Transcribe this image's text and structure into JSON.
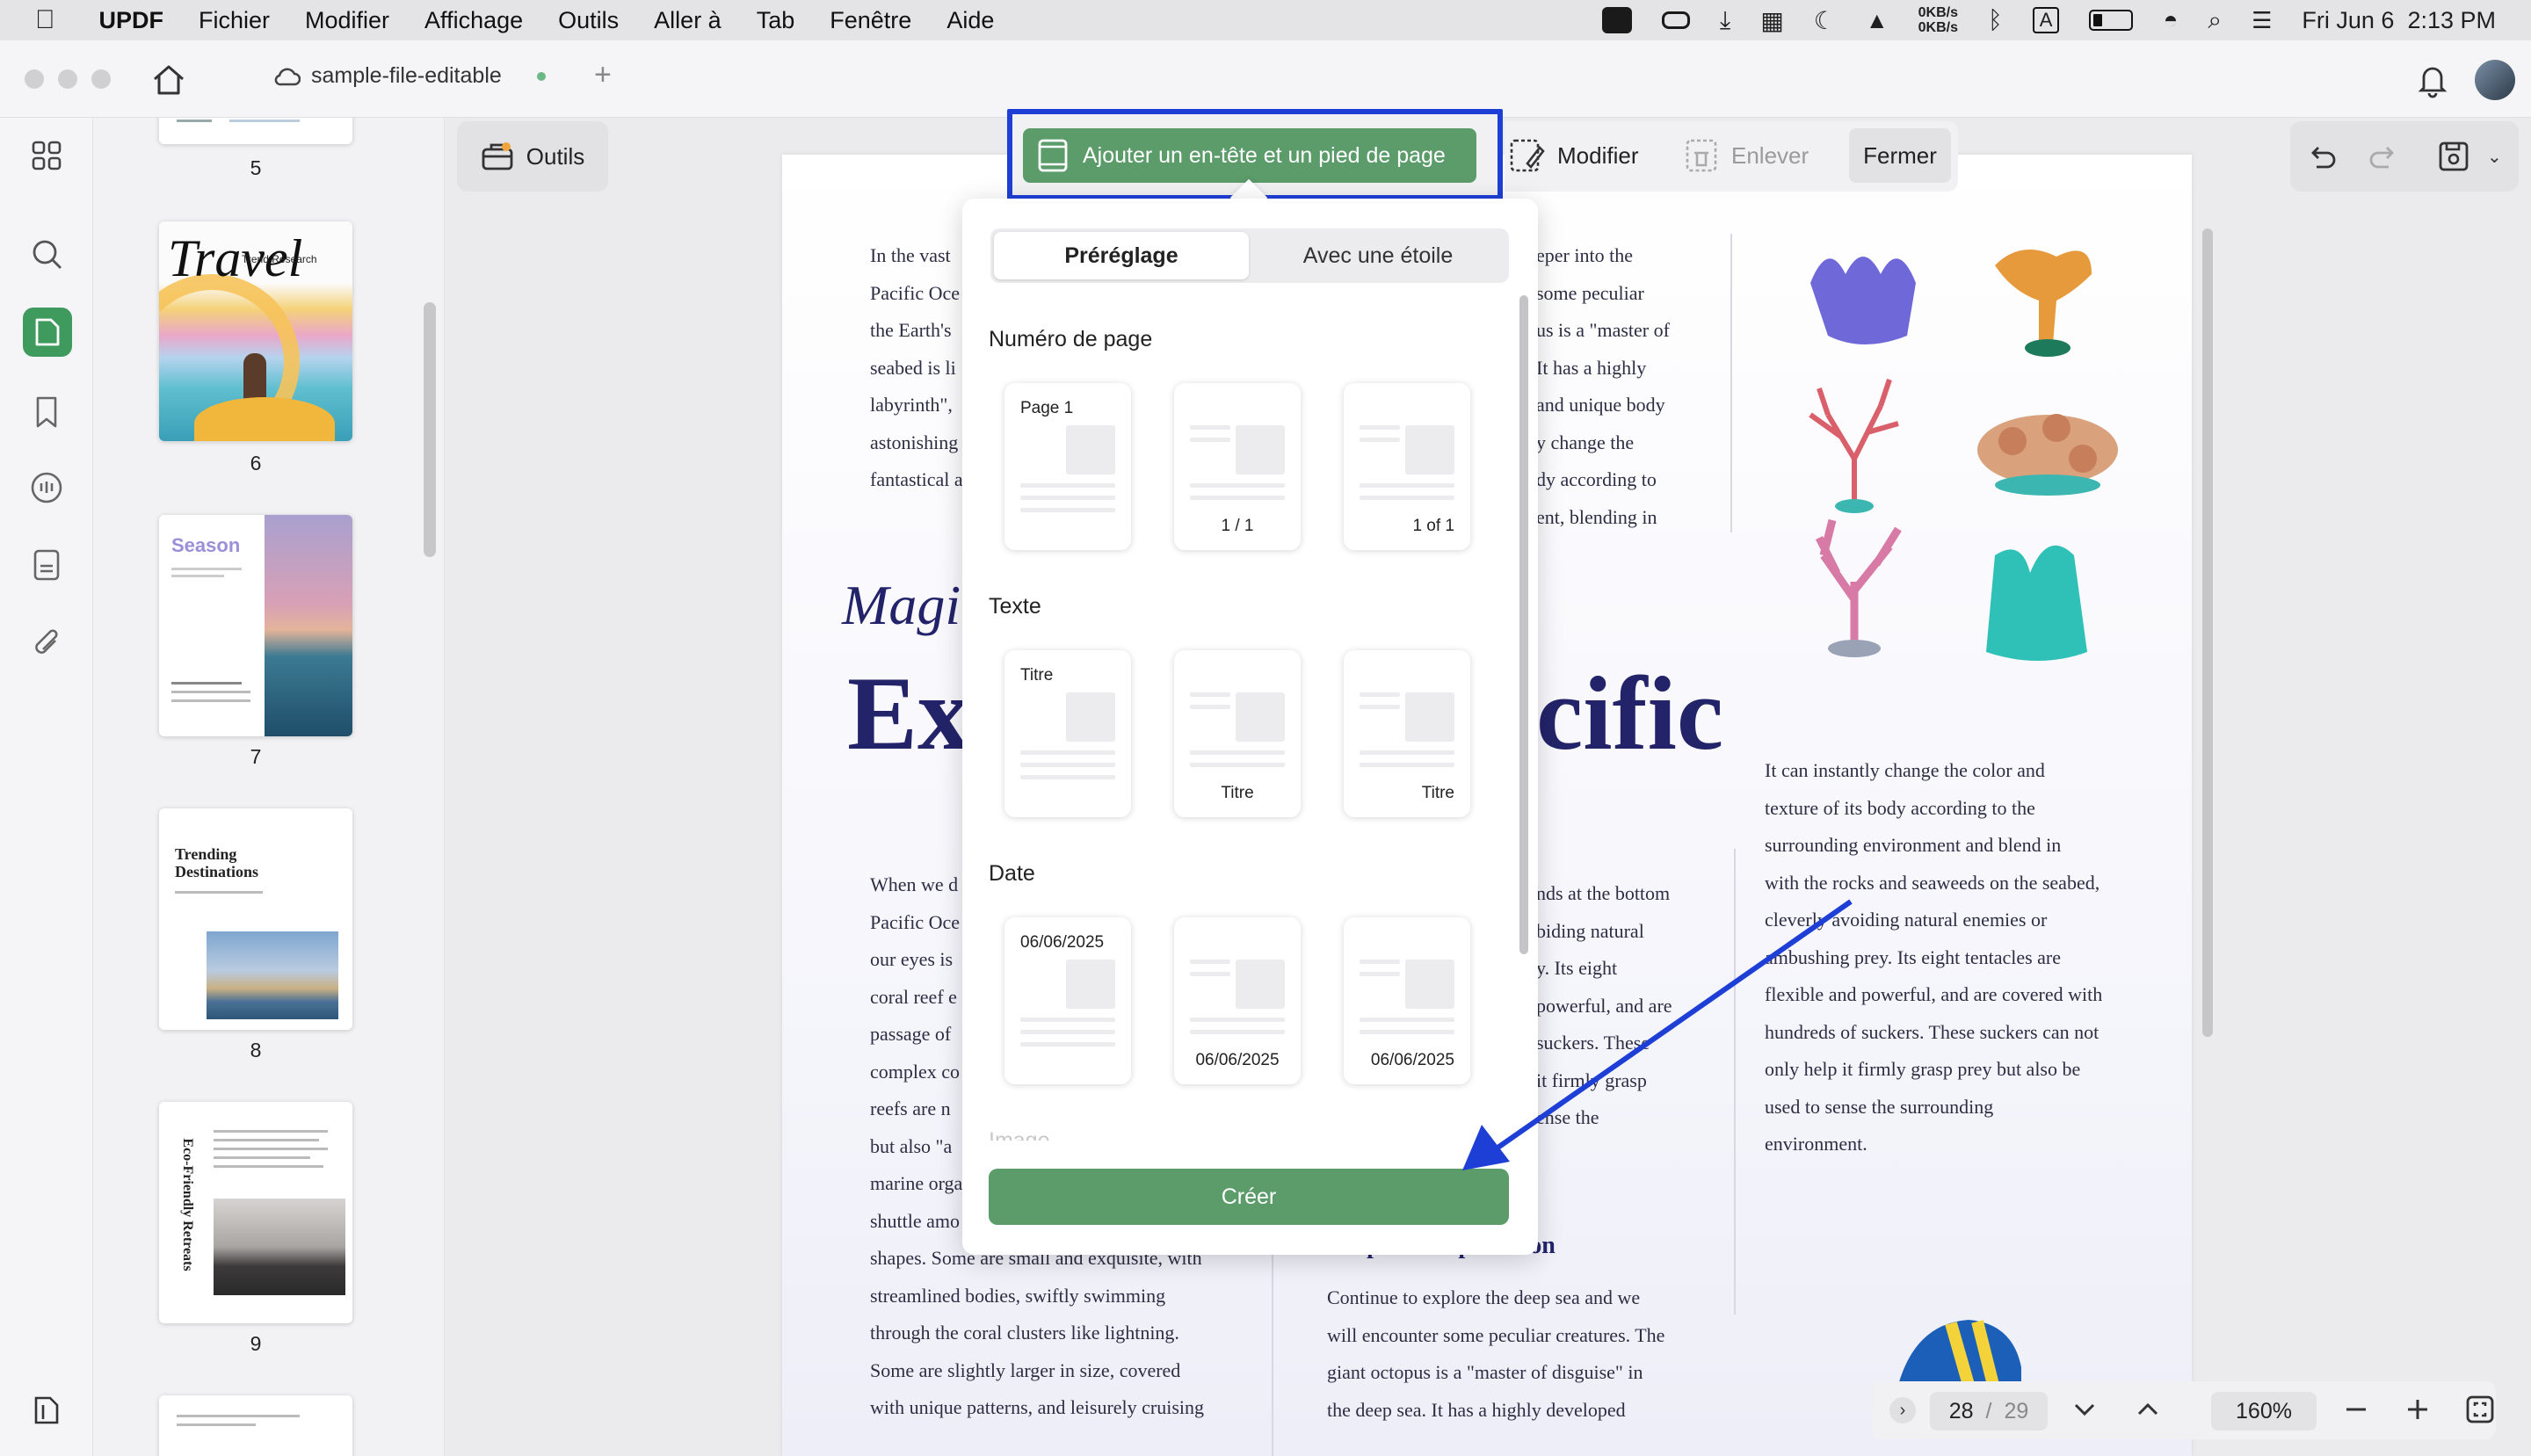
{
  "menubar": {
    "app_name": "UPDF",
    "items": [
      "Fichier",
      "Modifier",
      "Affichage",
      "Outils",
      "Aller à",
      "Tab",
      "Fenêtre",
      "Aide"
    ],
    "net_up": "0KB/s",
    "net_down": "0KB/s",
    "input_source": "A",
    "datetime": "Fri Jun 6  2:13 PM"
  },
  "titlebar": {
    "tab_title": "sample-file-editable",
    "new_tab": "+"
  },
  "thumbnails": [
    {
      "page": "5"
    },
    {
      "page": "6",
      "title": "Travel",
      "subtitle": "Trend Research"
    },
    {
      "page": "7",
      "title": "Season"
    },
    {
      "page": "8",
      "title": "Trending Destinations"
    },
    {
      "page": "9",
      "title": "Eco-Friendly Retreats"
    }
  ],
  "toolbar": {
    "tools_label": "Outils",
    "add_header_footer": "Ajouter un en-tête et un pied de page",
    "modify": "Modifier",
    "remove": "Enlever",
    "close": "Fermer"
  },
  "popup": {
    "tab_preset": "Préréglage",
    "tab_starred": "Avec une étoile",
    "section_page_number": "Numéro de page",
    "page_number_cards": [
      "Page 1",
      "1 / 1",
      "1 of 1"
    ],
    "section_text": "Texte",
    "text_cards": [
      "Titre",
      "Titre",
      "Titre"
    ],
    "section_date": "Date",
    "date_cards": [
      "06/06/2025",
      "06/06/2025",
      "06/06/2025"
    ],
    "section_image": "Image",
    "create_button": "Créer"
  },
  "document": {
    "col1_top": [
      "In the vast",
      "Pacific Oce",
      "the Earth's",
      "seabed is li",
      "labyrinth\",",
      "astonishing",
      "fantastical a"
    ],
    "col2_top": [
      "eper into the",
      "some peculiar",
      "us is a \"master of",
      "It has a highly",
      "and unique body",
      "y change the",
      "dy according to",
      "ent, blending in"
    ],
    "heading_italic": "Magi",
    "heading_big_left": "Ex",
    "heading_big_right": "cific",
    "col1_bottom": [
      "When we d",
      "Pacific Oce",
      "our eyes is",
      "coral reef e",
      "passage of",
      "complex co",
      "reefs are n",
      "but also \"a",
      "marine orga",
      "shuttle amo",
      "shapes. Some are small and exquisite, with",
      "streamlined bodies, swiftly swimming",
      "through the coral clusters like lightning.",
      "Some are slightly larger in size, covered",
      "with unique patterns, and leisurely cruising"
    ],
    "col2_bottom": [
      "nds at the bottom",
      "biding natural",
      "y. Its eight",
      "powerful, and are",
      "suckers. These",
      "it firmly grasp",
      "ense the"
    ],
    "deep_sea_heading": "Deep Sea Exploration",
    "deep_sea_text": [
      "Continue to explore the deep sea and we",
      "will encounter some peculiar creatures. The",
      "giant octopus is a \"master of disguise\" in",
      "the deep sea. It has a highly developed"
    ],
    "col3_text": [
      "It can instantly change the color and",
      "texture of its body according to the",
      "surrounding environment and blend in",
      "with the rocks and seaweeds on the seabed,",
      "cleverly avoiding natural enemies or",
      "ambushing prey. Its eight tentacles are",
      "flexible and powerful, and are covered with",
      "hundreds of suckers. These suckers can not",
      "only help it firmly grasp prey but also be",
      "used to sense the surrounding",
      "environment."
    ]
  },
  "pagenav": {
    "current": "28",
    "separator": "/",
    "total": "29",
    "zoom": "160%"
  },
  "colors": {
    "accent_green": "#5b9c6a",
    "highlight_blue": "#1d3fd6",
    "heading_navy": "#23236a"
  }
}
